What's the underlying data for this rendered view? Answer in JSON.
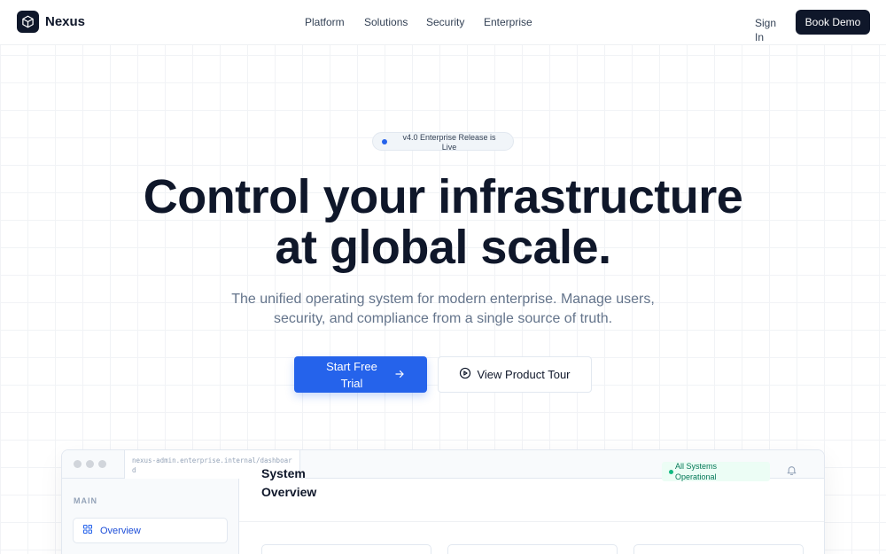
{
  "brand": {
    "name": "Nexus",
    "logo_icon": "cube-icon"
  },
  "nav": {
    "links": [
      {
        "label": "Platform"
      },
      {
        "label": "Solutions"
      },
      {
        "label": "Security"
      },
      {
        "label": "Enterprise"
      }
    ],
    "sign_in": "Sign In",
    "book_demo": "Book Demo"
  },
  "hero": {
    "badge": "v4.0 Enterprise Release is Live",
    "title_line1": "Control your infrastructure",
    "title_line2": "at global scale.",
    "subtitle": "The unified operating system for modern enterprise. Manage users, security, and compliance from a single source of truth.",
    "primary_cta": "Start Free Trial",
    "secondary_cta": "View Product Tour"
  },
  "preview": {
    "url": "nexus-admin.enterprise.internal/dashboard",
    "sidebar": {
      "heading": "MAIN",
      "items": [
        {
          "label": "Overview",
          "icon": "grid-icon"
        }
      ]
    },
    "main": {
      "title": "System Overview",
      "status": "All Systems Operational"
    }
  },
  "colors": {
    "accent": "#2563eb",
    "dark": "#0f172a",
    "success": "#10b981",
    "muted": "#64748b"
  }
}
